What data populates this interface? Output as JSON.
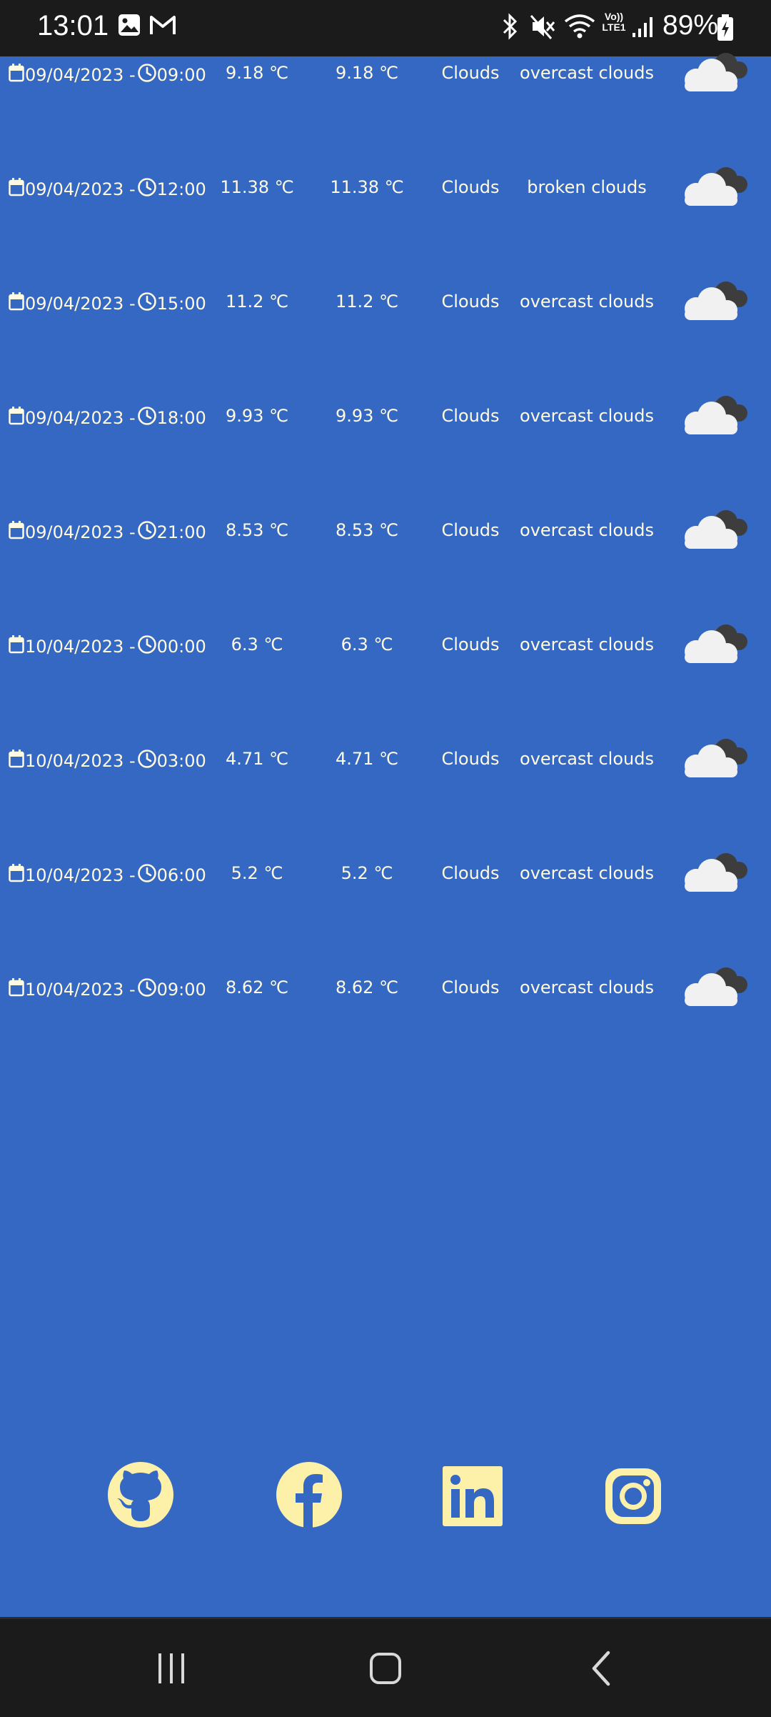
{
  "status_bar": {
    "time": "13:01",
    "battery_percent": "89%",
    "network_label": "Vo)) LTE1",
    "left_icons": [
      "image-icon",
      "gmail-icon"
    ],
    "right_icons": [
      "bluetooth-icon",
      "mute-icon",
      "wifi-icon",
      "signal-icon",
      "battery-charging-icon"
    ]
  },
  "forecast": [
    {
      "date": "09/04/2023 -",
      "time": "09:00",
      "temp": "9.18 ℃",
      "feels_like": "9.18 ℃",
      "main": "Clouds",
      "description": "overcast clouds",
      "icon": "overcast-clouds-icon"
    },
    {
      "date": "09/04/2023 -",
      "time": "12:00",
      "temp": "11.38 ℃",
      "feels_like": "11.38 ℃",
      "main": "Clouds",
      "description": "broken clouds",
      "icon": "broken-clouds-icon"
    },
    {
      "date": "09/04/2023 -",
      "time": "15:00",
      "temp": "11.2 ℃",
      "feels_like": "11.2 ℃",
      "main": "Clouds",
      "description": "overcast clouds",
      "icon": "overcast-clouds-icon"
    },
    {
      "date": "09/04/2023 -",
      "time": "18:00",
      "temp": "9.93 ℃",
      "feels_like": "9.93 ℃",
      "main": "Clouds",
      "description": "overcast clouds",
      "icon": "overcast-clouds-icon"
    },
    {
      "date": "09/04/2023 -",
      "time": "21:00",
      "temp": "8.53 ℃",
      "feels_like": "8.53 ℃",
      "main": "Clouds",
      "description": "overcast clouds",
      "icon": "overcast-clouds-icon"
    },
    {
      "date": "10/04/2023 -",
      "time": "00:00",
      "temp": "6.3 ℃",
      "feels_like": "6.3 ℃",
      "main": "Clouds",
      "description": "overcast clouds",
      "icon": "overcast-clouds-icon"
    },
    {
      "date": "10/04/2023 -",
      "time": "03:00",
      "temp": "4.71 ℃",
      "feels_like": "4.71 ℃",
      "main": "Clouds",
      "description": "overcast clouds",
      "icon": "overcast-clouds-icon"
    },
    {
      "date": "10/04/2023 -",
      "time": "06:00",
      "temp": "5.2 ℃",
      "feels_like": "5.2 ℃",
      "main": "Clouds",
      "description": "overcast clouds",
      "icon": "overcast-clouds-icon"
    },
    {
      "date": "10/04/2023 -",
      "time": "09:00",
      "temp": "8.62 ℃",
      "feels_like": "8.62 ℃",
      "main": "Clouds",
      "description": "overcast clouds",
      "icon": "overcast-clouds-icon"
    }
  ],
  "social_links": [
    {
      "name": "GitHub",
      "icon": "github-icon"
    },
    {
      "name": "Facebook",
      "icon": "facebook-icon"
    },
    {
      "name": "LinkedIn",
      "icon": "linkedin-icon"
    },
    {
      "name": "Instagram",
      "icon": "instagram-icon"
    }
  ],
  "nav_bar": {
    "buttons": [
      "recent-apps-icon",
      "home-icon",
      "back-icon"
    ]
  },
  "colors": {
    "background": "#3568c3",
    "text": "#fffbe0",
    "social_icon": "#fdf0a8",
    "system_bar": "#1b1b1b"
  }
}
